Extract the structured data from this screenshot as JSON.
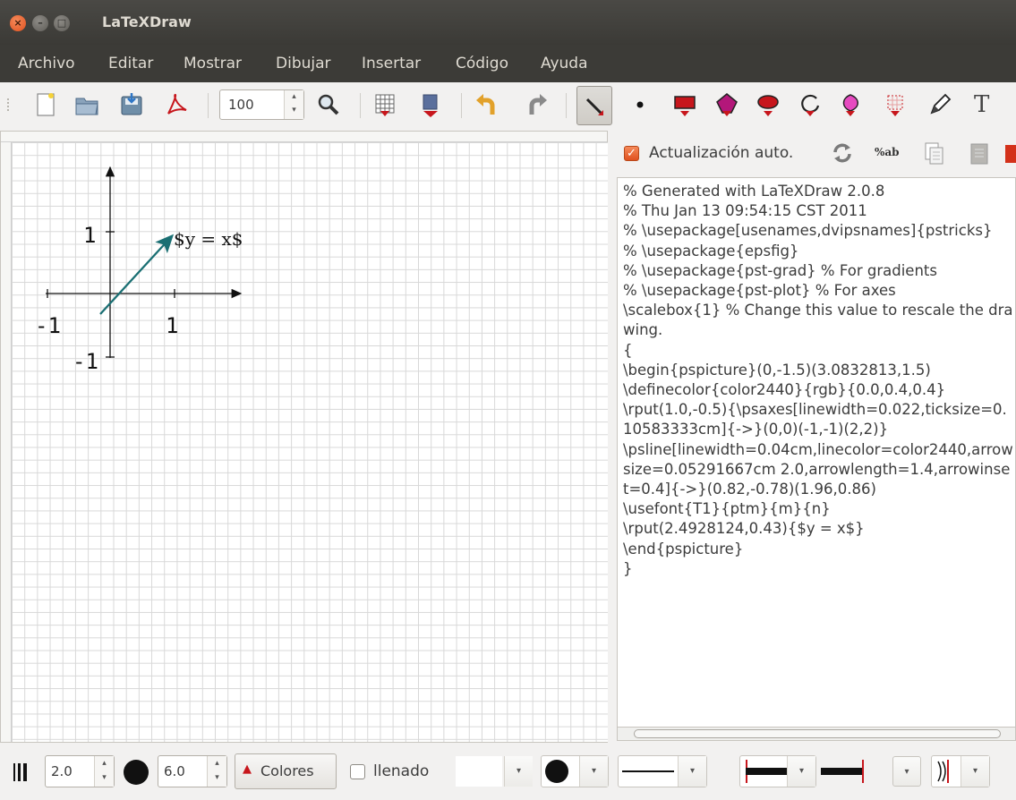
{
  "window": {
    "title": "LaTeXDraw",
    "close_glyph": "×",
    "min_glyph": "–",
    "max_glyph": "□"
  },
  "menu": [
    "Archivo",
    "Editar",
    "Mostrar",
    "Dibujar",
    "Insertar",
    "Código",
    "Ayuda"
  ],
  "toolbar": {
    "zoom_value": "100",
    "text_tool_glyph": "T",
    "icons": [
      "new-file-icon",
      "open-folder-icon",
      "save-icon",
      "pdf-export-icon",
      "zoom-icon",
      "grid-icon",
      "export-icon",
      "undo-icon",
      "redo-icon",
      "select-arrow-icon",
      "dot-icon",
      "rectangle-icon",
      "polygon-icon",
      "ellipse-icon",
      "arc-icon",
      "bezier-icon",
      "grid-shape-icon",
      "pencil-icon",
      "text-icon"
    ],
    "accent": "#c7161c"
  },
  "drawing": {
    "label_y1": "1",
    "label_x_neg": "-1",
    "label_x1": "1",
    "label_y_neg": "-1",
    "equation": "$y = x$",
    "line_color": "#1a6f73"
  },
  "code_panel": {
    "auto_update_label": "Actualización auto.",
    "check_glyph": "✓",
    "format_button": "%ab",
    "code": "% Generated with LaTeXDraw 2.0.8\n% Thu Jan 13 09:54:15 CST 2011\n% \\usepackage[usenames,dvipsnames]{pstricks}\n% \\usepackage{epsfig}\n% \\usepackage{pst-grad} % For gradients\n% \\usepackage{pst-plot} % For axes\n\\scalebox{1} % Change this value to rescale the drawing.\n{\n\\begin{pspicture}(0,-1.5)(3.0832813,1.5)\n\\definecolor{color2440}{rgb}{0.0,0.4,0.4}\n\\rput(1.0,-0.5){\\psaxes[linewidth=0.022,ticksize=0.10583333cm]{->}(0,0)(-1,-1)(2,2)}\n\\psline[linewidth=0.04cm,linecolor=color2440,arrowsize=0.05291667cm 2.0,arrowlength=1.4,arrowinset=0.4]{->}(0.82,-0.78)(1.96,0.86)\n\\usefont{T1}{ptm}{m}{n}\n\\rput(2.4928124,0.43){$y = x$}\n\\end{pspicture}\n}"
  },
  "bottom": {
    "line_width": "2.0",
    "dot_size": "6.0",
    "colors_button": "Colores",
    "colors_glyph": "▲",
    "fill_label": "llenado",
    "combo_arrow_glyph": "▾",
    "spin_up_glyph": "▴",
    "spin_down_glyph": "▾"
  }
}
